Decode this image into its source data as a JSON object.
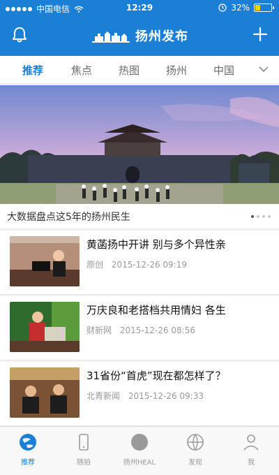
{
  "status_bar": {
    "carrier": "中国电信",
    "time": "12:29",
    "battery_percent": "32%"
  },
  "header": {
    "logo_text": "扬州发布"
  },
  "tabs": [
    {
      "label": "推荐",
      "active": true
    },
    {
      "label": "焦点",
      "active": false
    },
    {
      "label": "热图",
      "active": false
    },
    {
      "label": "扬州",
      "active": false
    },
    {
      "label": "中国",
      "active": false
    }
  ],
  "banner": {
    "caption": "大数据盘点这5年的扬州民生",
    "indicator_total": 4,
    "indicator_active": 1
  },
  "news": [
    {
      "title": "黄菡扬中开讲 别与多个异性亲",
      "source": "原创",
      "time": "2015-12-26 09:19"
    },
    {
      "title": "万庆良和老搭档共用情妇 各生",
      "source": "财新网",
      "time": "2015-12-26 08:56"
    },
    {
      "title": "31省份“首虎”现在都怎样了？",
      "source": "北青新闻",
      "time": "2015-12-26 09:33"
    }
  ],
  "bottom_nav": [
    {
      "label": "推荐",
      "icon": "globe-icon",
      "active": true
    },
    {
      "label": "随拍",
      "icon": "phone-icon",
      "active": false
    },
    {
      "label": "扬州HEAL",
      "icon": "circle-icon",
      "active": false
    },
    {
      "label": "发现",
      "icon": "discover-globe-icon",
      "active": false
    },
    {
      "label": "我",
      "icon": "user-icon",
      "active": false
    }
  ],
  "colors": {
    "primary": "#1b7fd6",
    "inactive": "#9a9a9a",
    "battery": "#f5d300"
  }
}
